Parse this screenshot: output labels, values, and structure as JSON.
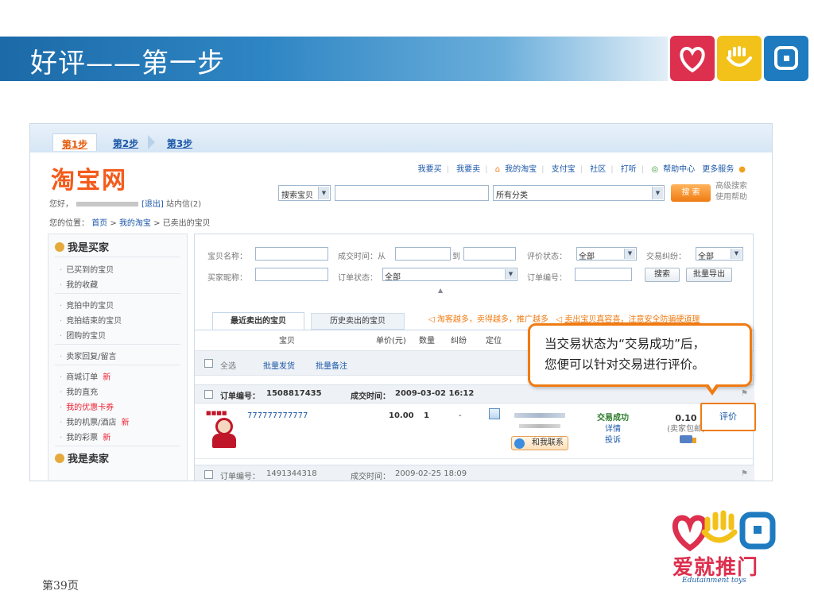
{
  "slide": {
    "title": "好评——第一步",
    "page": "第39页"
  },
  "header_icons": [
    "heart-icon",
    "hand-icon",
    "rounded-square-icon"
  ],
  "steps": [
    "第1步",
    "第2步",
    "第3步"
  ],
  "taobao": {
    "logo": "淘宝网",
    "greeting": "您好，",
    "logout": "[退出]",
    "messages": "站内信(2)",
    "topnav": [
      "我要买",
      "我要卖",
      "我的淘宝",
      "支付宝",
      "社区",
      "打听",
      "帮助中心",
      "更多服务"
    ],
    "search_type": "搜索宝贝",
    "category": "所有分类",
    "search_button": "搜 索",
    "advanced_search": "高级搜索",
    "help": "使用帮助",
    "breadcrumb": {
      "label": "您的位置：",
      "home": "首页",
      "mytaobao": "我的淘宝",
      "current": "已卖出的宝贝"
    }
  },
  "sidebar": {
    "buyer_title": "我是买家",
    "seller_title": "我是卖家",
    "new_label": "新",
    "items": [
      "已买到的宝贝",
      "我的收藏",
      "竞拍中的宝贝",
      "竞拍结束的宝贝",
      "团购的宝贝",
      "卖家回复/留言",
      "商城订单",
      "我的直充",
      "我的优惠卡券",
      "我的机票/酒店",
      "我的彩票"
    ]
  },
  "filters": {
    "item_name": "宝贝名称：",
    "deal_time_from": "成交时间：从",
    "to": "到",
    "rate_status": "评价状态：",
    "rate_status_value": "全部",
    "dispute": "交易纠纷：",
    "dispute_value": "全部",
    "buyer_nick": "买家昵称：",
    "order_status": "订单状态：",
    "order_status_value": "全部",
    "order_no": "订单编号：",
    "search_btn": "搜索",
    "export_btn": "批量导出"
  },
  "tabs": {
    "recent": "最近卖出的宝贝",
    "history": "历史卖出的宝贝"
  },
  "promo": [
    "淘客越多，卖得越多，推广越多",
    "卖出宝贝真容喜，注意安全防骗硬道理"
  ],
  "columns": [
    "宝贝",
    "单价(元)",
    "数量",
    "纠纷",
    "定位"
  ],
  "toolbar": {
    "select_all": "全选",
    "batch_ship": "批量发货",
    "batch_note": "批量备注"
  },
  "orders": [
    {
      "order_no_label": "订单编号：",
      "order_no": "1508817435",
      "deal_time_label": "成交时间：",
      "deal_time": "2009-03-02 16:12",
      "title": "777777777777",
      "price": "10.00",
      "qty": "1",
      "dispute": "-",
      "contact": "和我联系",
      "status": "交易成功",
      "detail": "详情",
      "complain": "投诉",
      "total": "0.10",
      "shipping": "(卖家包邮)",
      "rate": "评价"
    },
    {
      "order_no_label": "订单编号：",
      "order_no": "1491344318",
      "deal_time_label": "成交时间：",
      "deal_time": "2009-02-25 18:09"
    }
  ],
  "callout": {
    "line1": "当交易状态为“交易成功”后，",
    "line2": "您便可以针对交易进行评价。"
  },
  "brand": {
    "cn": "爱就推门",
    "en": "Edutainment toys"
  },
  "colors": {
    "accent": "#f07b12",
    "link": "#1a56a8",
    "title_bar": "#2f86c4"
  }
}
